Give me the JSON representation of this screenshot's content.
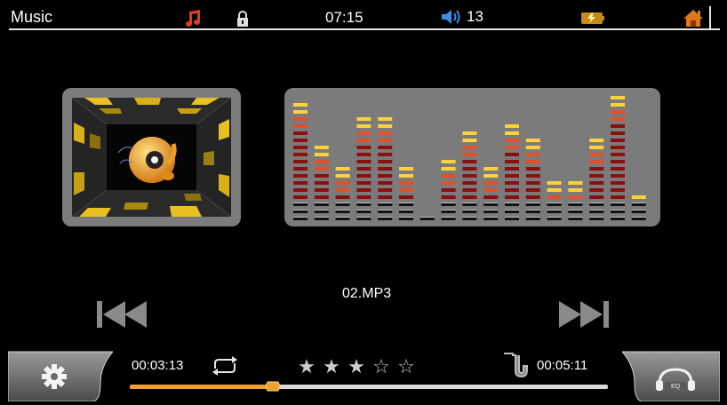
{
  "status": {
    "title": "Music",
    "time": "07:15",
    "volume": "13",
    "icons": [
      "music-note-icon",
      "lock-icon",
      "speaker-icon",
      "battery-icon",
      "home-icon"
    ]
  },
  "player": {
    "track": "02.MP3",
    "elapsed": "00:03:13",
    "total": "00:05:11",
    "progress_fraction": 0.3,
    "rating": 3,
    "rating_max": 5
  },
  "equalizer": {
    "levels": [
      0.93,
      0.62,
      0.45,
      0.84,
      0.84,
      0.45,
      0.08,
      0.49,
      0.73,
      0.45,
      0.76,
      0.69,
      0.34,
      0.34,
      0.69,
      0.98,
      0.21
    ]
  },
  "colors": {
    "accent": "#f0a030",
    "panel": "#7b7b7b",
    "eq_top": "#ffd23a",
    "eq_mid": "#e0502a",
    "eq_low": "#8a1010"
  }
}
